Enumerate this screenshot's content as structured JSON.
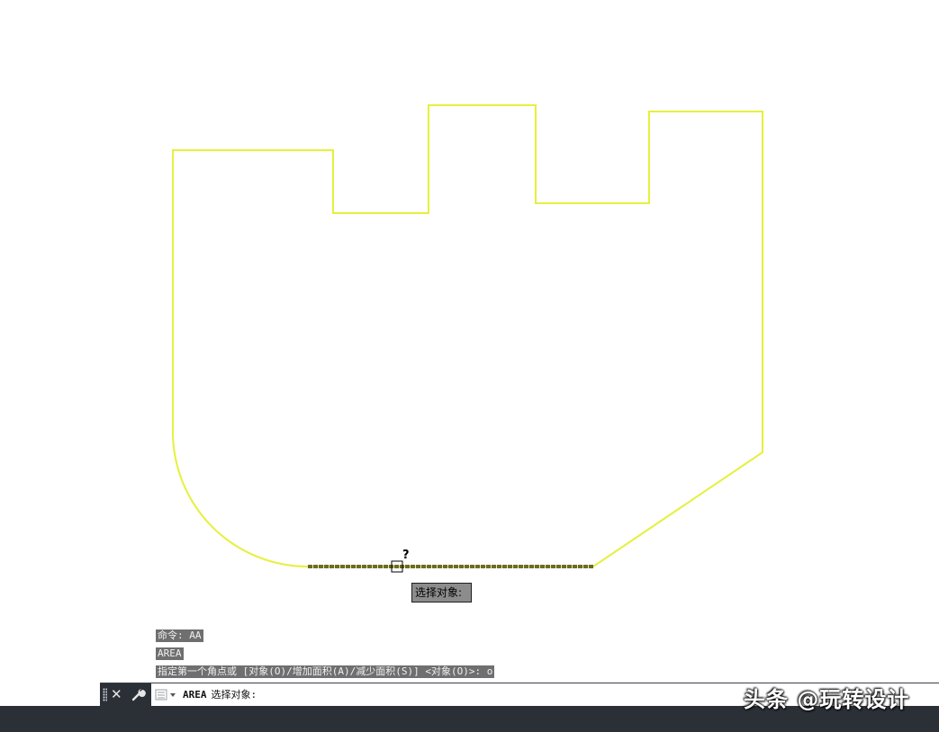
{
  "drawing": {
    "outline_color": "#e6f03c",
    "highlight_color": "#6b6b2e",
    "cursor_badge": "?"
  },
  "tooltip": {
    "text": "选择对象:"
  },
  "command_history": [
    "命令: AA",
    "AREA",
    "指定第一个角点或 [对象(O)/增加面积(A)/减少面积(S)] <对象(O)>: o"
  ],
  "command_line": {
    "command": "AREA",
    "prompt": "选择对象:",
    "close_icon": "close-icon",
    "settings_icon": "wrench-icon",
    "recent_icon": "recent-commands-icon"
  },
  "watermark": {
    "text": "头条 @玩转设计"
  },
  "colors": {
    "command_bar_dark": "#2b2f36",
    "history_bg": "#6f6f6f",
    "tooltip_bg": "#8c8c8c"
  }
}
